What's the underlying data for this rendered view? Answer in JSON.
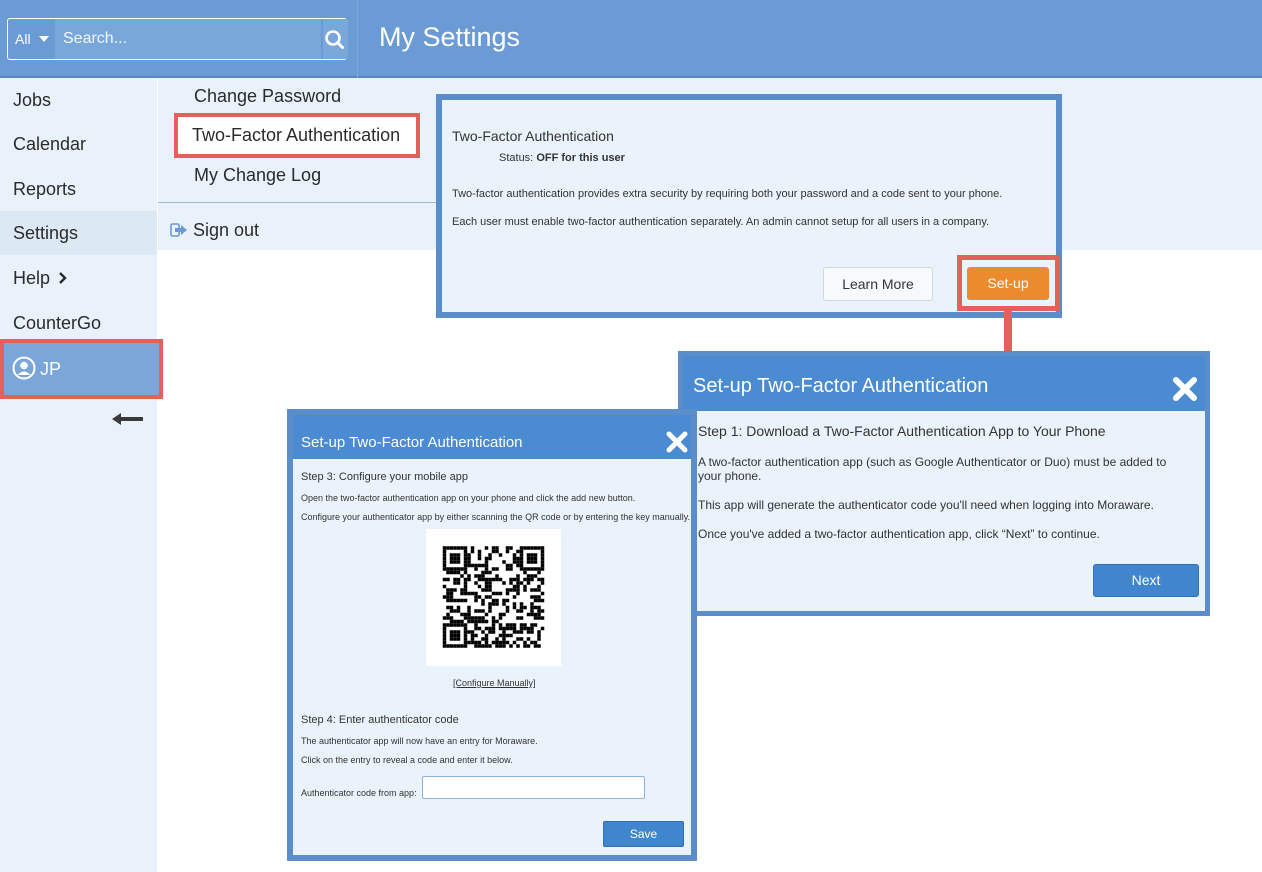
{
  "header": {
    "scope": "All",
    "search_placeholder": "Search...",
    "title": "My Settings"
  },
  "sidebar": {
    "items": [
      {
        "label": "Jobs"
      },
      {
        "label": "Calendar"
      },
      {
        "label": "Reports"
      },
      {
        "label": "Settings"
      },
      {
        "label": "Help"
      },
      {
        "label": "CounterGo"
      }
    ],
    "user_label": "JP"
  },
  "submenu": {
    "change_password": "Change Password",
    "two_factor": "Two-Factor Authentication",
    "change_log": "My Change Log",
    "sign_out": "Sign out"
  },
  "tfa_panel": {
    "title": "Two-Factor Authentication",
    "status_label": "Status:",
    "status_value": "OFF for this user",
    "desc1": "Two-factor authentication provides extra security by requiring both your password and a code sent to your phone.",
    "desc2": "Each user must enable two-factor authentication separately.  An admin cannot setup for all users in a company.",
    "learn_more": "Learn More",
    "setup": "Set-up"
  },
  "step1_dialog": {
    "title": "Set-up Two-Factor Authentication",
    "heading": "Step 1: Download a Two-Factor Authentication App to Your Phone",
    "p1": "A two-factor authentication app (such as Google Authenticator or Duo) must be added to your phone.",
    "p2": "This app will generate the authenticator code you'll need when logging into Moraware.",
    "p3": "Once you've added a two-factor authentication app, click “Next” to continue.",
    "next": "Next"
  },
  "step3_dialog": {
    "title": "Set-up Two-Factor Authentication",
    "step3_heading": "Step 3: Configure your mobile app",
    "step3_p1": "Open the two-factor authentication app on your phone and click the add new button.",
    "step3_p2": "Configure your authenticator app by either scanning the QR code or by entering the key manually.",
    "configure_link": "[Configure Manually]",
    "step4_heading": "Step 4: Enter authenticator code",
    "step4_p1": "The authenticator app will now have an entry for Moraware.",
    "step4_p2": "Click on the entry to reveal a code and enter it below.",
    "code_label": "Authenticator code from app:",
    "save": "Save"
  },
  "colors": {
    "header": "#6a9bd4",
    "highlight": "#e4605b",
    "setup_button": "#ec8a2e",
    "primary_button": "#3f86ce"
  }
}
